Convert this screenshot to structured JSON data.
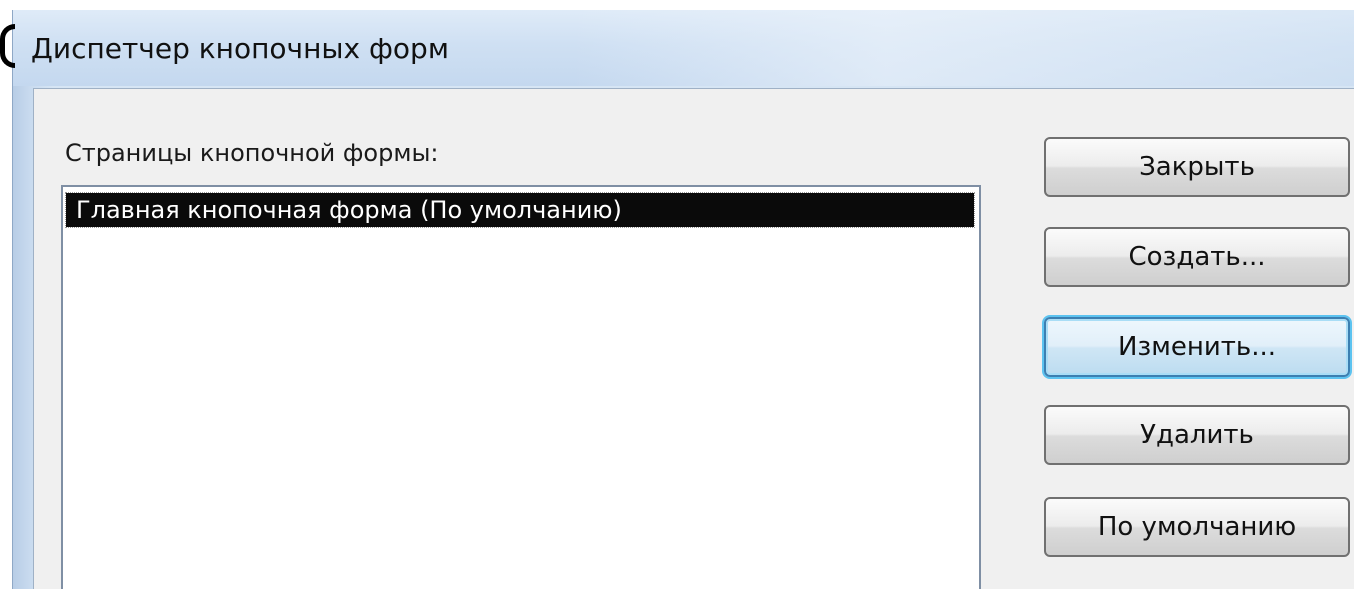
{
  "window": {
    "title": "Диспетчер кнопочных форм"
  },
  "main": {
    "list_label": "Страницы кнопочной формы:",
    "list_items": [
      {
        "label": "Главная кнопочная форма (По умолчанию)",
        "selected": true
      }
    ]
  },
  "buttons": {
    "close": "Закрыть",
    "create": "Создать...",
    "edit": "Изменить...",
    "delete": "Удалить",
    "default": "По умолчанию"
  },
  "colors": {
    "titlebar": "#cfe0f3",
    "dialog_bg": "#f0f0f0",
    "selection_bg": "#0a0a0a",
    "focus_ring": "#5cc3f0"
  }
}
